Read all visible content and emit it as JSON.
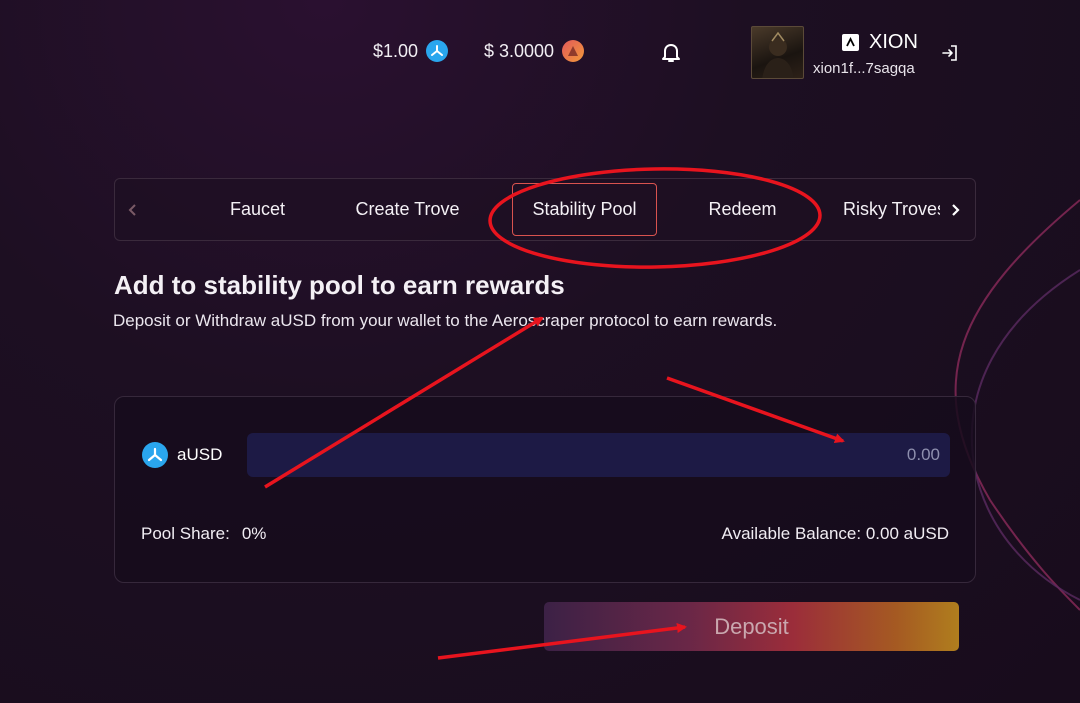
{
  "header": {
    "ausd_price": "$1.00",
    "ausd_icon": "ausd-coin-icon",
    "arch_price": "$ 3.0000",
    "arch_icon": "arch-coin-icon",
    "notification_icon": "bell-icon",
    "wallet": {
      "chain_name": "XION",
      "address": "xion1f...7sagqa",
      "logout_icon": "logout-icon"
    }
  },
  "tabs": {
    "items": [
      {
        "label": "Faucet"
      },
      {
        "label": "Create Trove"
      },
      {
        "label": "Stability Pool",
        "active": true
      },
      {
        "label": "Redeem"
      },
      {
        "label": "Risky Troves"
      }
    ]
  },
  "page": {
    "title": "Add to stability pool to earn rewards",
    "subtitle": "Deposit or Withdraw aUSD from your wallet to the Aeroscraper protocol to earn rewards."
  },
  "form": {
    "token_label": "aUSD",
    "amount_placeholder": "0.00",
    "pool_share_label": "Pool Share:",
    "pool_share_value": "0%",
    "available_balance": "Available Balance: 0.00 aUSD",
    "deposit_label": "Deposit"
  },
  "colors": {
    "accent_red": "#d9534f",
    "ausd_blue": "#2aa6ee",
    "input_bg": "#1d1a45",
    "annotation_red": "#e8141e"
  }
}
